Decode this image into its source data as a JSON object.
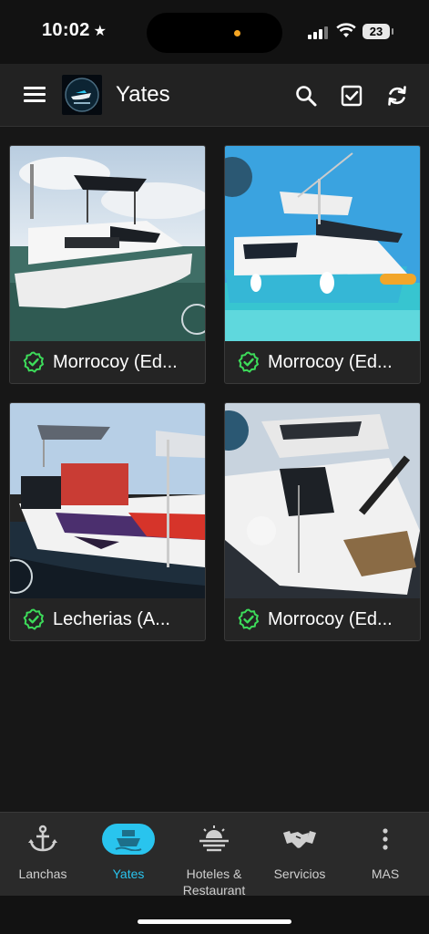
{
  "status_bar": {
    "time": "10:02",
    "battery": "23"
  },
  "app_bar": {
    "title": "Yates"
  },
  "listings": [
    {
      "name": "Morrocoy (Ed...",
      "verified": true
    },
    {
      "name": "Morrocoy (Ed...",
      "verified": true
    },
    {
      "name": "Lecherias (A...",
      "verified": true
    },
    {
      "name": "Morrocoy (Ed...",
      "verified": true
    }
  ],
  "bottom_nav": {
    "tabs": [
      {
        "label": "Lanchas",
        "icon": "anchor-icon"
      },
      {
        "label": "Yates",
        "icon": "ship-icon",
        "active": true
      },
      {
        "label": "Hoteles &\nRestaurant",
        "icon": "sunset-icon"
      },
      {
        "label": "Servicios",
        "icon": "handshake-icon"
      },
      {
        "label": "MAS",
        "icon": "more-vertical-icon"
      }
    ]
  },
  "colors": {
    "accent": "#29c4ee",
    "verified": "#3ddc5a",
    "background": "#171717"
  }
}
